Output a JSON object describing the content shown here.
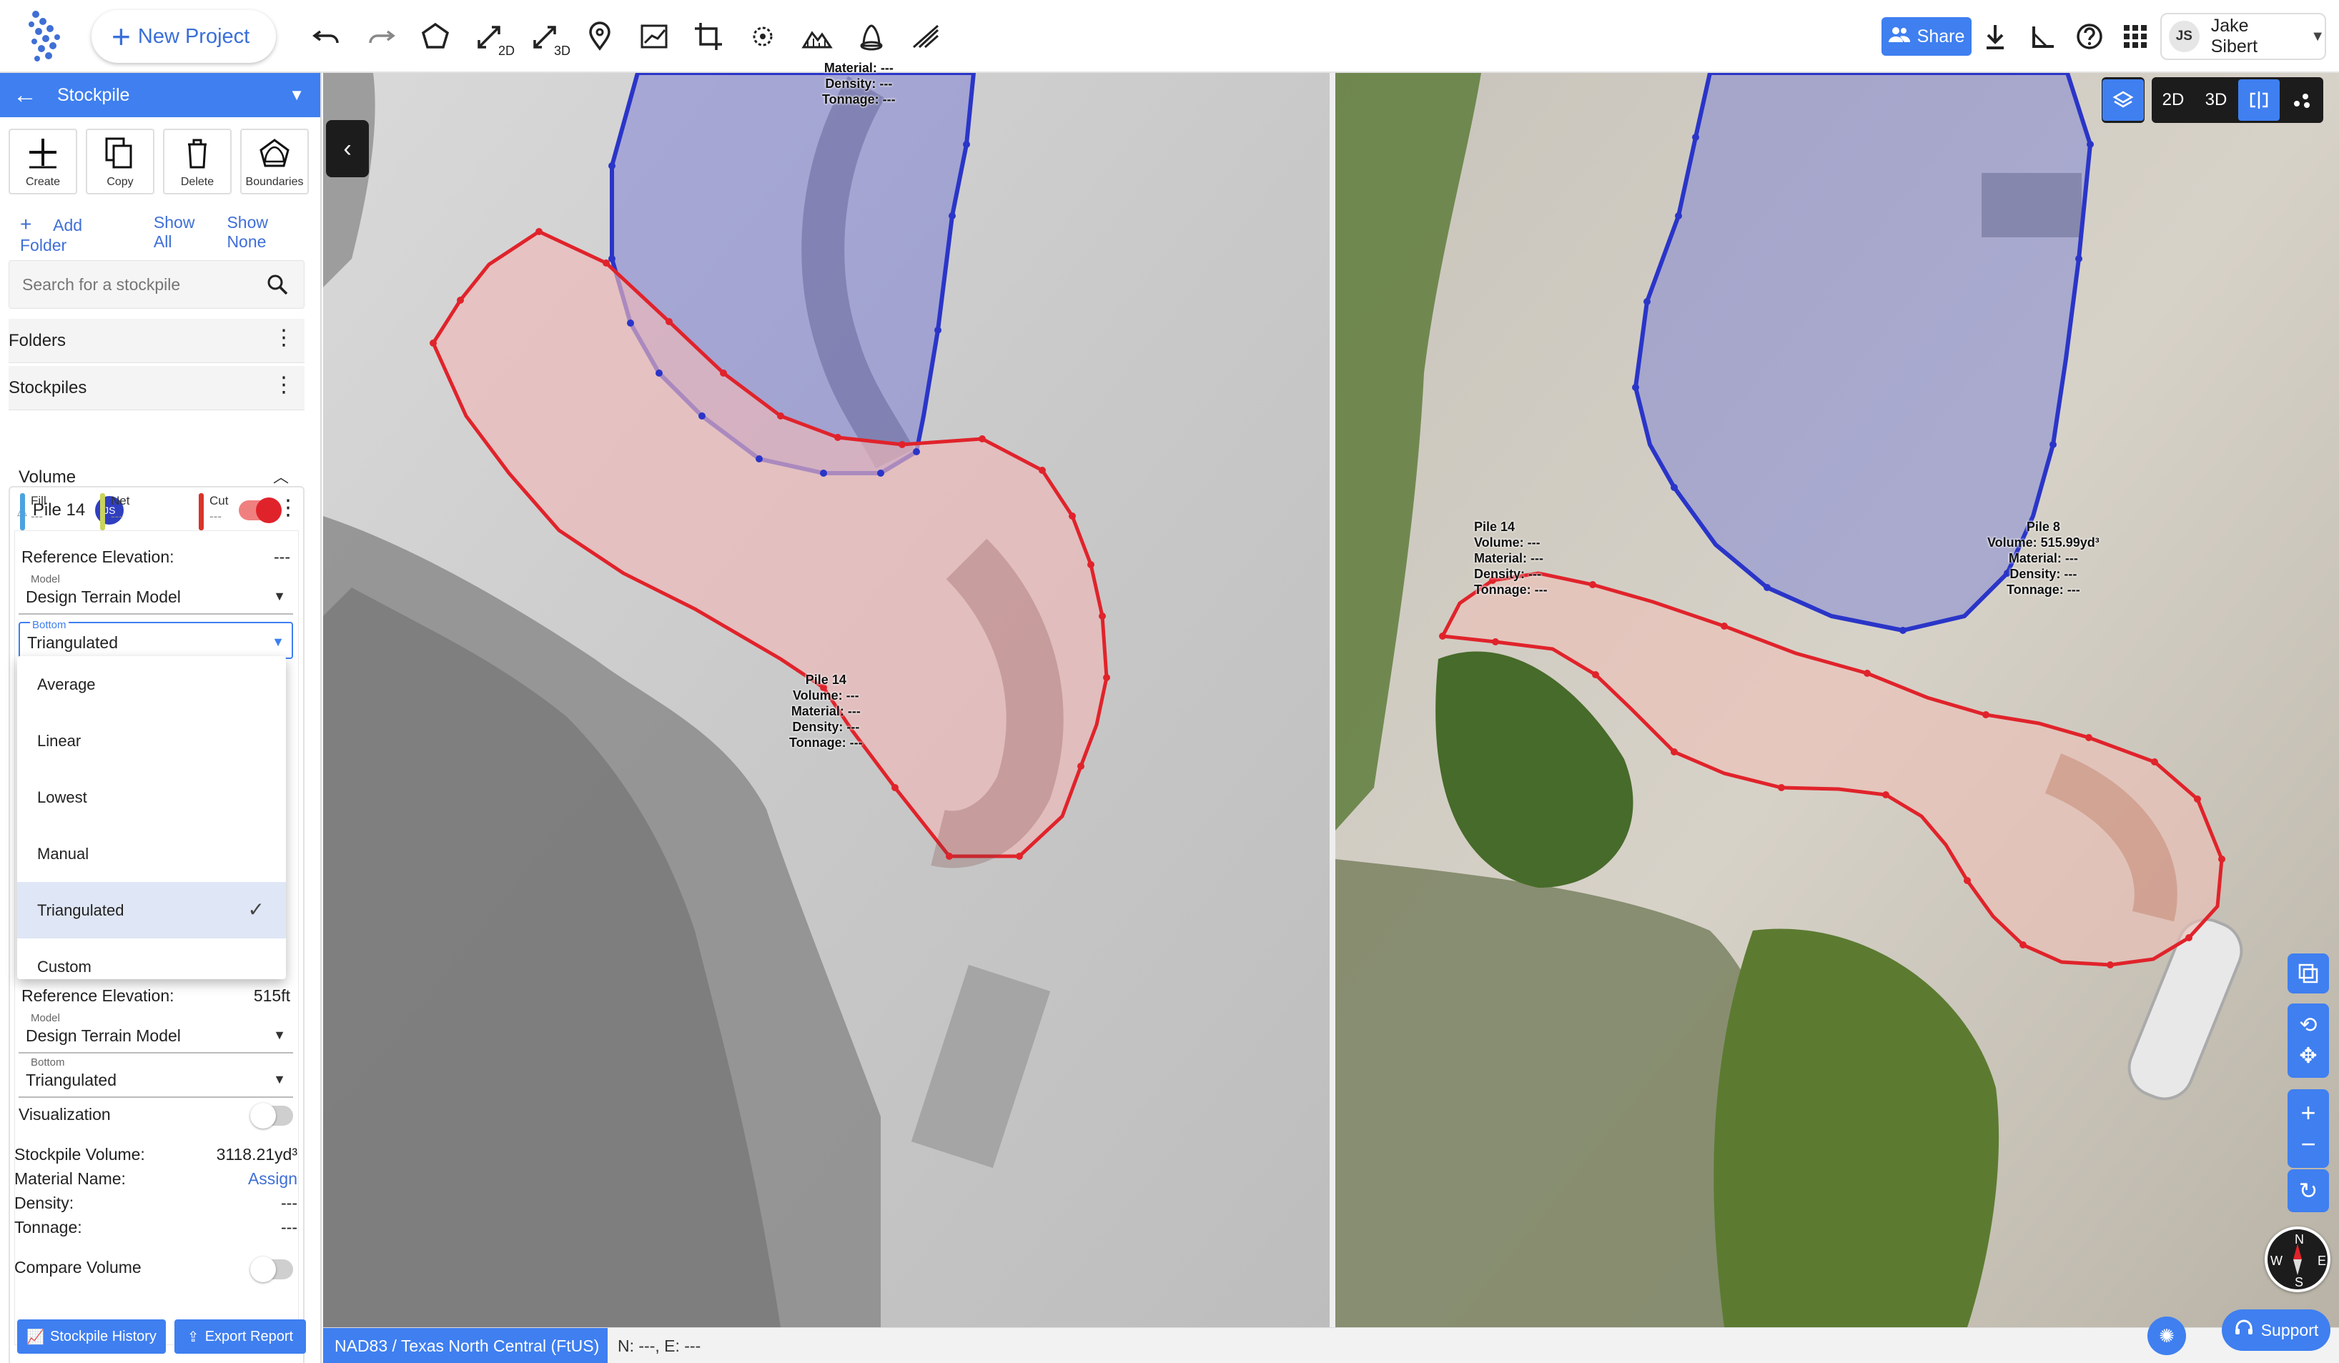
{
  "toolbar": {
    "new_project_label": "New Project",
    "tool_2d_sub": "2D",
    "tool_3d_sub": "3D",
    "share_label": "Share",
    "user_initials": "JS",
    "user_name": "Jake Sibert"
  },
  "sidebar": {
    "title": "Stockpile",
    "actions": [
      {
        "label": "Create",
        "icon": "plus-icon"
      },
      {
        "label": "Copy",
        "icon": "copy-icon"
      },
      {
        "label": "Delete",
        "icon": "trash-icon"
      },
      {
        "label": "Boundaries",
        "icon": "boundaries-icon"
      }
    ],
    "add_folder": "Add Folder",
    "show_all": "Show All",
    "show_none": "Show None",
    "search_placeholder": "Search for a stockpile",
    "folders_label": "Folders",
    "stockpiles_label": "Stockpiles",
    "pile": {
      "name": "Pile 14",
      "badge": "JS",
      "volume_title": "Volume",
      "legend": [
        {
          "label": "Fill",
          "value": "---",
          "color": "#4aa3df"
        },
        {
          "label": "Net",
          "value": "---",
          "color": "#c8d45a"
        },
        {
          "label": "Cut",
          "value": "---",
          "color": "#d9342b"
        }
      ],
      "ref_elevation_label": "Reference Elevation:",
      "ref_elevation_value": "---",
      "model_small": "Model",
      "model_value": "Design Terrain Model",
      "bottom_small": "Bottom",
      "bottom_value": "Triangulated",
      "dropdown_options": [
        "Average",
        "Linear",
        "Lowest",
        "Manual",
        "Triangulated",
        "Custom"
      ],
      "dropdown_selected": "Triangulated",
      "ref_elevation2_value": "515ft",
      "model2_value": "Design Terrain Model",
      "bottom2_value": "Triangulated",
      "visualization_label": "Visualization",
      "stockpile_volume_label": "Stockpile Volume:",
      "stockpile_volume_value": "3118.21yd³",
      "material_name_label": "Material Name:",
      "material_name_value": "Assign",
      "density_label": "Density:",
      "density_value": "---",
      "tonnage_label": "Tonnage:",
      "tonnage_value": "---",
      "compare_volume_label": "Compare Volume"
    },
    "stockpile_history": "Stockpile History",
    "export_report": "Export Report"
  },
  "map": {
    "left_pile14": {
      "title": "Pile 14",
      "volume": "Volume: ---",
      "material": "Material: ---",
      "density": "Density: ---",
      "tonnage": "Tonnage: ---"
    },
    "left_pile8": {
      "material": "Material: ---",
      "density": "Density: ---",
      "tonnage": "Tonnage: ---"
    },
    "right_pile14": {
      "title": "Pile 14",
      "volume": "Volume: ---",
      "material": "Material: ---",
      "density": "Density: ---",
      "tonnage": "Tonnage: ---"
    },
    "right_pile8": {
      "title": "Pile 8",
      "volume": "Volume: 515.99yd³",
      "material": "Material: ---",
      "density": "Density: ---",
      "tonnage": "Tonnage: ---"
    },
    "view_2d": "2D",
    "view_3d": "3D",
    "compass": {
      "n": "N",
      "s": "S",
      "e": "E",
      "w": "W"
    }
  },
  "status": {
    "crs": "NAD83 / Texas North Central (FtUS)",
    "coords": "N: ---, E: ---",
    "support": "Support"
  },
  "colors": {
    "accent": "#3f7ff0",
    "pile14_outline": "#e0232b",
    "pile8_outline": "#2a35c8"
  }
}
